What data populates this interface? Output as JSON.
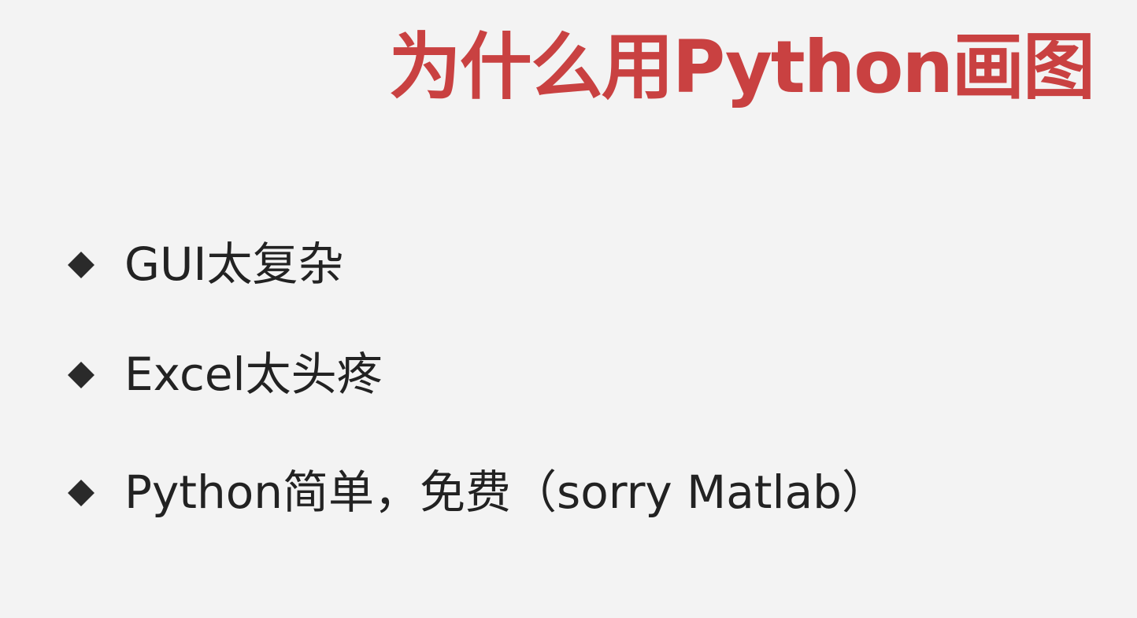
{
  "slide": {
    "title": "为什么用Python画图",
    "bullets": [
      {
        "icon": "diamond-bullet-icon",
        "text": "GUI太复杂"
      },
      {
        "icon": "diamond-bullet-icon",
        "text": "Excel太头疼"
      },
      {
        "icon": "diamond-bullet-icon",
        "text": "Python简单，免费（sorry Matlab）"
      }
    ]
  },
  "colors": {
    "title": "#c94141",
    "text": "#222222",
    "background": "#f3f3f3"
  }
}
